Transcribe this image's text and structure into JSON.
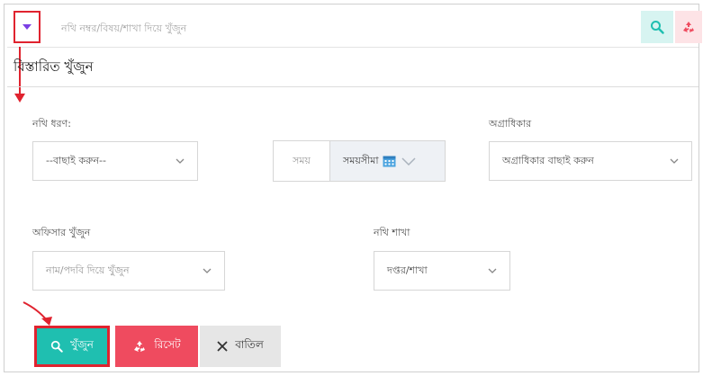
{
  "search": {
    "placeholder": "নথি নম্বর/বিষয়/শাখা দিয়ে খুঁজুন"
  },
  "panel": {
    "title": "বিস্তারিত খুঁজুন"
  },
  "filters": {
    "file_type": {
      "label": "নথি ধরণ:",
      "value": "--বাছাই করুন--"
    },
    "date": {
      "label": "সময়",
      "value": "সময়সীমা"
    },
    "priority": {
      "label": "অগ্রাধিকার",
      "value": "অগ্রাধিকার বাছাই করুন"
    },
    "officer": {
      "label": "অফিসার খুঁজুন",
      "placeholder": "নাম/পদবি দিয়ে খুঁজুন"
    },
    "branch": {
      "label": "নথি শাখা",
      "value": "দপ্তর/শাখা"
    }
  },
  "actions": {
    "search_label": "খুঁজুন",
    "reset_label": "রিসেট",
    "cancel_label": "বাতিল"
  },
  "icons": {
    "toggle": "caret-down-icon",
    "search": "search-icon",
    "reset": "recycle-icon",
    "calendar": "calendar-icon",
    "chevron": "chevron-down-icon",
    "close": "close-icon"
  },
  "colors": {
    "accent_teal": "#1fbfb0",
    "accent_red": "#ef4b5f",
    "highlight_red": "#e0232f",
    "toggle_purple": "#7b3fe4"
  }
}
